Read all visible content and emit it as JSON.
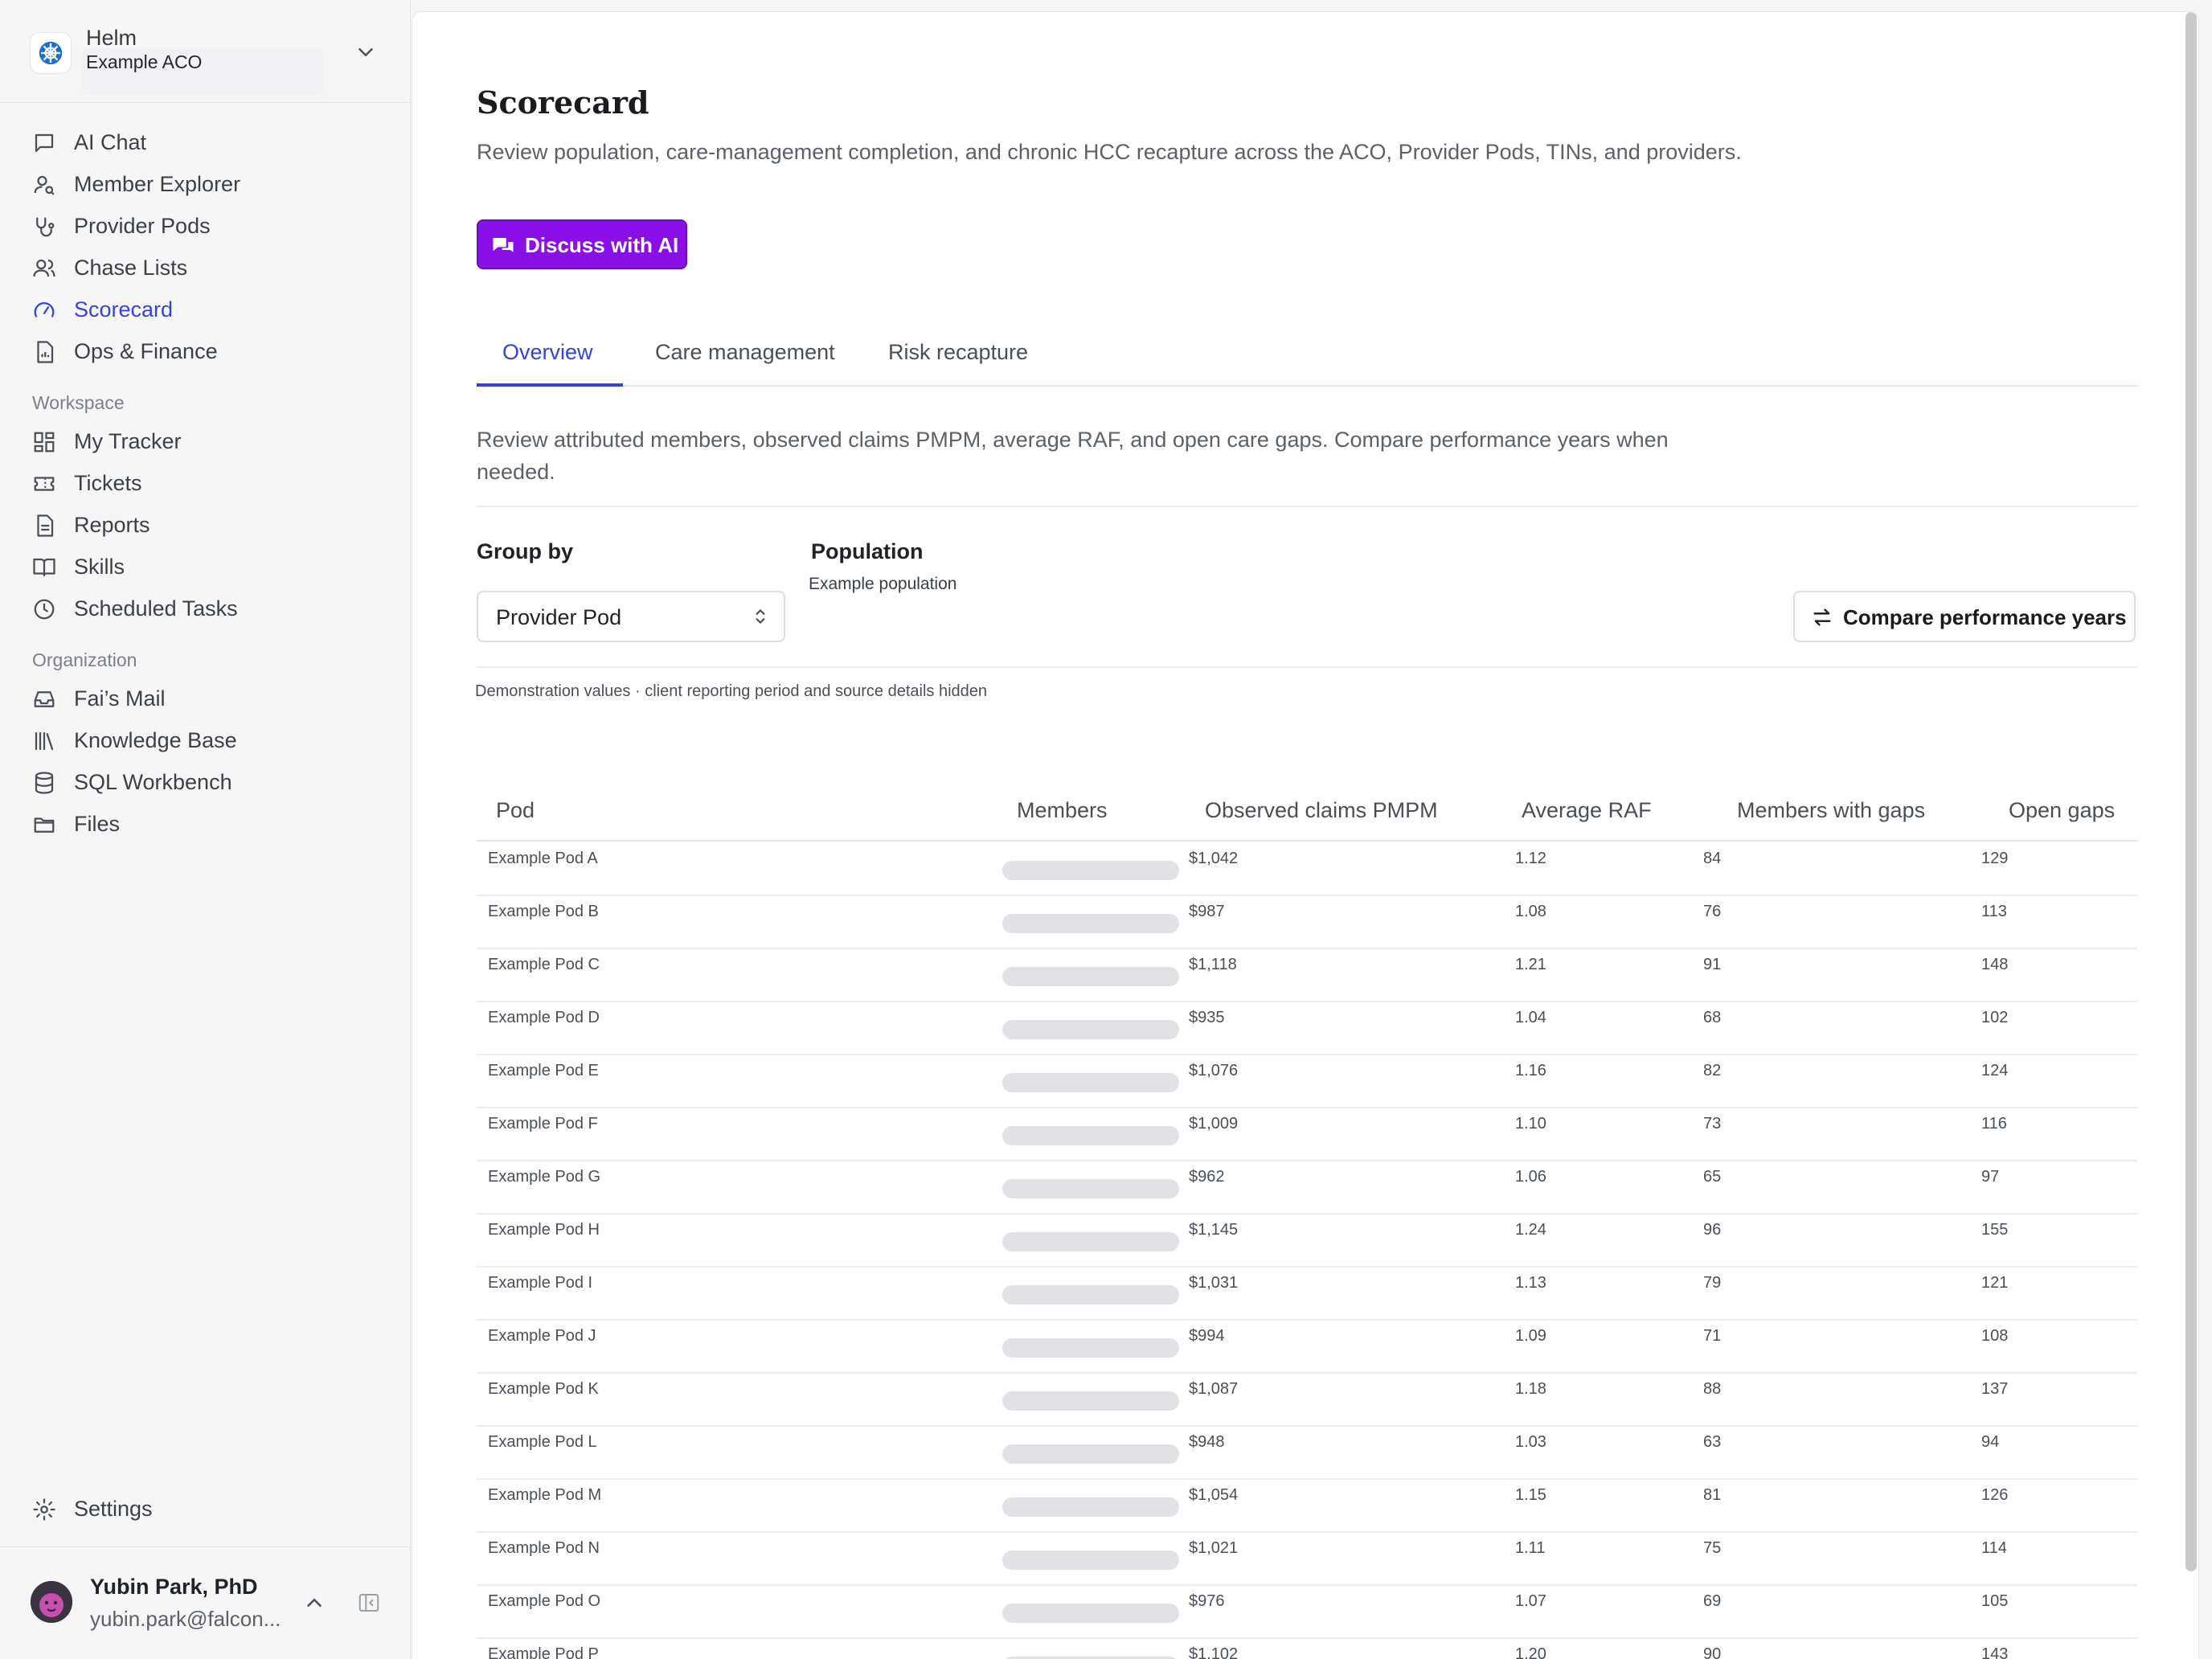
{
  "brand": {
    "name": "Helm",
    "org": "Example ACO"
  },
  "nav": {
    "items": [
      {
        "label": "AI Chat",
        "icon": "chat-icon"
      },
      {
        "label": "Member Explorer",
        "icon": "user-search-icon"
      },
      {
        "label": "Provider Pods",
        "icon": "stethoscope-icon"
      },
      {
        "label": "Chase Lists",
        "icon": "users-icon"
      },
      {
        "label": "Scorecard",
        "icon": "gauge-icon",
        "active": true
      },
      {
        "label": "Ops & Finance",
        "icon": "file-chart-icon"
      }
    ],
    "workspace_label": "Workspace",
    "workspace": [
      {
        "label": "My Tracker",
        "icon": "dashboard-icon"
      },
      {
        "label": "Tickets",
        "icon": "ticket-icon"
      },
      {
        "label": "Reports",
        "icon": "document-icon"
      },
      {
        "label": "Skills",
        "icon": "book-icon"
      },
      {
        "label": "Scheduled Tasks",
        "icon": "clock-icon"
      }
    ],
    "organization_label": "Organization",
    "organization": [
      {
        "label": "Fai’s Mail",
        "icon": "inbox-icon"
      },
      {
        "label": "Knowledge Base",
        "icon": "library-icon"
      },
      {
        "label": "SQL Workbench",
        "icon": "database-icon"
      },
      {
        "label": "Files",
        "icon": "folder-icon"
      }
    ],
    "settings": "Settings"
  },
  "user": {
    "name": "Yubin Park, PhD",
    "email": "yubin.park@falcon..."
  },
  "page": {
    "title": "Scorecard",
    "subtitle": "Review population, care-management completion, and chronic HCC recapture across the ACO, Provider Pods, TINs, and providers.",
    "ai_button": "Discuss with AI",
    "tabs": [
      "Overview",
      "Care management",
      "Risk recapture"
    ],
    "active_tab": "Overview",
    "description": "Review attributed members, observed claims PMPM, average RAF, and open care gaps. Compare performance years when needed.",
    "group_by_label": "Group by",
    "group_by_value": "Provider Pod",
    "population_label": "Population",
    "population_value": "Example population",
    "compare_button": "Compare performance years",
    "note": "Demonstration values · client reporting period and source details hidden"
  },
  "table": {
    "headers": [
      "Pod",
      "Members",
      "Observed claims PMPM",
      "Average RAF",
      "Members with gaps",
      "Open gaps"
    ],
    "rows": [
      {
        "pod": "Example Pod A",
        "pmpm": "$1,042",
        "raf": "1.12",
        "members_gaps": "84",
        "open_gaps": "129"
      },
      {
        "pod": "Example Pod B",
        "pmpm": "$987",
        "raf": "1.08",
        "members_gaps": "76",
        "open_gaps": "113"
      },
      {
        "pod": "Example Pod C",
        "pmpm": "$1,118",
        "raf": "1.21",
        "members_gaps": "91",
        "open_gaps": "148"
      },
      {
        "pod": "Example Pod D",
        "pmpm": "$935",
        "raf": "1.04",
        "members_gaps": "68",
        "open_gaps": "102"
      },
      {
        "pod": "Example Pod E",
        "pmpm": "$1,076",
        "raf": "1.16",
        "members_gaps": "82",
        "open_gaps": "124"
      },
      {
        "pod": "Example Pod F",
        "pmpm": "$1,009",
        "raf": "1.10",
        "members_gaps": "73",
        "open_gaps": "116"
      },
      {
        "pod": "Example Pod G",
        "pmpm": "$962",
        "raf": "1.06",
        "members_gaps": "65",
        "open_gaps": "97"
      },
      {
        "pod": "Example Pod H",
        "pmpm": "$1,145",
        "raf": "1.24",
        "members_gaps": "96",
        "open_gaps": "155"
      },
      {
        "pod": "Example Pod I",
        "pmpm": "$1,031",
        "raf": "1.13",
        "members_gaps": "79",
        "open_gaps": "121"
      },
      {
        "pod": "Example Pod J",
        "pmpm": "$994",
        "raf": "1.09",
        "members_gaps": "71",
        "open_gaps": "108"
      },
      {
        "pod": "Example Pod K",
        "pmpm": "$1,087",
        "raf": "1.18",
        "members_gaps": "88",
        "open_gaps": "137"
      },
      {
        "pod": "Example Pod L",
        "pmpm": "$948",
        "raf": "1.03",
        "members_gaps": "63",
        "open_gaps": "94"
      },
      {
        "pod": "Example Pod M",
        "pmpm": "$1,054",
        "raf": "1.15",
        "members_gaps": "81",
        "open_gaps": "126"
      },
      {
        "pod": "Example Pod N",
        "pmpm": "$1,021",
        "raf": "1.11",
        "members_gaps": "75",
        "open_gaps": "114"
      },
      {
        "pod": "Example Pod O",
        "pmpm": "$976",
        "raf": "1.07",
        "members_gaps": "69",
        "open_gaps": "105"
      },
      {
        "pod": "Example Pod P",
        "pmpm": "$1,102",
        "raf": "1.20",
        "members_gaps": "90",
        "open_gaps": "143"
      }
    ]
  },
  "colors": {
    "accent": "#3544d6",
    "ai_button": "#8a0fe6",
    "placeholder_bar": "#e2e2e6"
  }
}
